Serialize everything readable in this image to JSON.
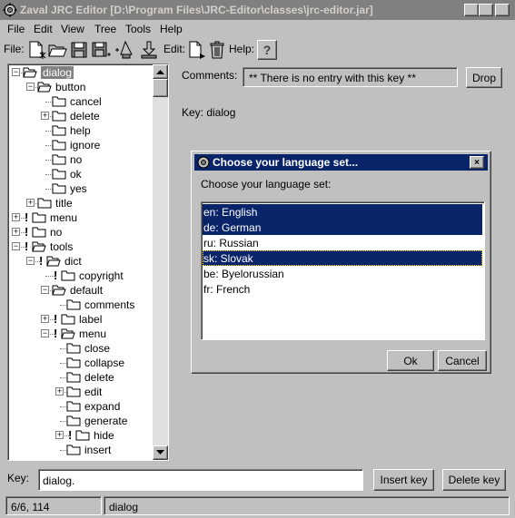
{
  "window": {
    "title": "Zaval JRC Editor [D:\\Program Files\\JRC-Editor\\classes\\jrc-editor.jar]",
    "controls": {
      "minimize": "_",
      "maximize": "□",
      "close": "×"
    }
  },
  "menu": [
    "File",
    "Edit",
    "View",
    "Tree",
    "Tools",
    "Help"
  ],
  "toolbar": {
    "file_label": "File:",
    "edit_label": "Edit:",
    "help_label": "Help:",
    "icons": [
      "new-file-icon",
      "open-folder-icon",
      "save-disk-icon",
      "save-as-icon",
      "tree-add-icon",
      "download-icon",
      "new-entry-icon",
      "trash-icon",
      "help-question-icon"
    ]
  },
  "tree": {
    "nodes": [
      {
        "label": "dialog",
        "level": 0,
        "expander": "minus",
        "folder": "open",
        "bang": false,
        "selected": true
      },
      {
        "label": "button",
        "level": 1,
        "expander": "minus",
        "folder": "open",
        "bang": false
      },
      {
        "label": "cancel",
        "level": 2,
        "expander": "",
        "folder": "closed",
        "bang": false
      },
      {
        "label": "delete",
        "level": 2,
        "expander": "plus",
        "folder": "closed",
        "bang": false
      },
      {
        "label": "help",
        "level": 2,
        "expander": "",
        "folder": "closed",
        "bang": false
      },
      {
        "label": "ignore",
        "level": 2,
        "expander": "",
        "folder": "closed",
        "bang": false
      },
      {
        "label": "no",
        "level": 2,
        "expander": "",
        "folder": "closed",
        "bang": false
      },
      {
        "label": "ok",
        "level": 2,
        "expander": "",
        "folder": "closed",
        "bang": false
      },
      {
        "label": "yes",
        "level": 2,
        "expander": "",
        "folder": "closed",
        "bang": false
      },
      {
        "label": "title",
        "level": 1,
        "expander": "plus",
        "folder": "closed",
        "bang": false
      },
      {
        "label": "menu",
        "level": 0,
        "expander": "plus",
        "folder": "closed",
        "bang": true
      },
      {
        "label": "no",
        "level": 0,
        "expander": "plus",
        "folder": "closed",
        "bang": true
      },
      {
        "label": "tools",
        "level": 0,
        "expander": "minus",
        "folder": "open",
        "bang": true
      },
      {
        "label": "dict",
        "level": 1,
        "expander": "minus",
        "folder": "open",
        "bang": true
      },
      {
        "label": "copyright",
        "level": 2,
        "expander": "",
        "folder": "closed",
        "bang": true
      },
      {
        "label": "default",
        "level": 2,
        "expander": "minus",
        "folder": "open",
        "bang": false
      },
      {
        "label": "comments",
        "level": 3,
        "expander": "",
        "folder": "closed",
        "bang": false
      },
      {
        "label": "label",
        "level": 2,
        "expander": "plus",
        "folder": "closed",
        "bang": true
      },
      {
        "label": "menu",
        "level": 2,
        "expander": "minus",
        "folder": "open",
        "bang": true
      },
      {
        "label": "close",
        "level": 3,
        "expander": "",
        "folder": "closed",
        "bang": false
      },
      {
        "label": "collapse",
        "level": 3,
        "expander": "",
        "folder": "closed",
        "bang": false
      },
      {
        "label": "delete",
        "level": 3,
        "expander": "",
        "folder": "closed",
        "bang": false
      },
      {
        "label": "edit",
        "level": 3,
        "expander": "plus",
        "folder": "closed",
        "bang": false
      },
      {
        "label": "expand",
        "level": 3,
        "expander": "",
        "folder": "closed",
        "bang": false
      },
      {
        "label": "generate",
        "level": 3,
        "expander": "",
        "folder": "closed",
        "bang": false
      },
      {
        "label": "hide",
        "level": 3,
        "expander": "plus",
        "folder": "closed",
        "bang": true
      },
      {
        "label": "insert",
        "level": 3,
        "expander": "",
        "folder": "closed",
        "bang": false
      }
    ]
  },
  "comments": {
    "label": "Comments:",
    "value": "** There is no entry with this key **",
    "drop_button": "Drop"
  },
  "key_display": "Key: dialog",
  "dialog": {
    "title": "Choose your language set...",
    "prompt": "Choose your language set:",
    "languages": [
      {
        "label": "en: English",
        "selected": true
      },
      {
        "label": "de: German",
        "selected": true
      },
      {
        "label": "ru: Russian",
        "selected": false
      },
      {
        "label": "sk: Slovak",
        "selected": true
      },
      {
        "label": "be: Byelorussian",
        "selected": false
      },
      {
        "label": "fr: French",
        "selected": false
      }
    ],
    "ok": "Ok",
    "cancel": "Cancel",
    "close": "×"
  },
  "bottom": {
    "key_label": "Key:",
    "key_value": "dialog.",
    "insert_button": "Insert key",
    "delete_button": "Delete key"
  },
  "status": {
    "position": "6/6, 114",
    "current": "dialog"
  }
}
